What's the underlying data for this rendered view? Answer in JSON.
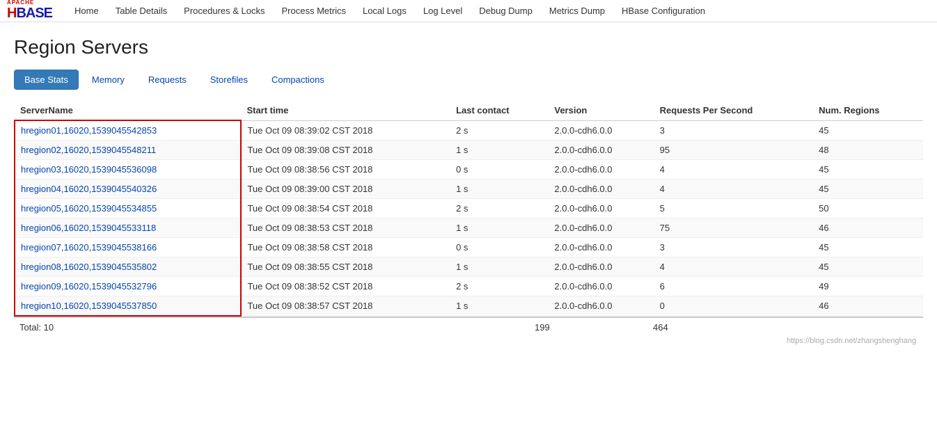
{
  "nav": {
    "links": [
      {
        "label": "Home",
        "name": "home-link"
      },
      {
        "label": "Table Details",
        "name": "table-details-link"
      },
      {
        "label": "Procedures & Locks",
        "name": "procedures-locks-link"
      },
      {
        "label": "Process Metrics",
        "name": "process-metrics-link"
      },
      {
        "label": "Local Logs",
        "name": "local-logs-link"
      },
      {
        "label": "Log Level",
        "name": "log-level-link"
      },
      {
        "label": "Debug Dump",
        "name": "debug-dump-link"
      },
      {
        "label": "Metrics Dump",
        "name": "metrics-dump-link"
      },
      {
        "label": "HBase Configuration",
        "name": "hbase-config-link"
      }
    ]
  },
  "page": {
    "title": "Region Servers"
  },
  "tabs": [
    {
      "label": "Base Stats",
      "active": true,
      "name": "tab-base-stats"
    },
    {
      "label": "Memory",
      "active": false,
      "name": "tab-memory"
    },
    {
      "label": "Requests",
      "active": false,
      "name": "tab-requests"
    },
    {
      "label": "Storefiles",
      "active": false,
      "name": "tab-storefiles"
    },
    {
      "label": "Compactions",
      "active": false,
      "name": "tab-compactions"
    }
  ],
  "table": {
    "columns": [
      {
        "label": "ServerName",
        "name": "col-server-name"
      },
      {
        "label": "Start time",
        "name": "col-start-time"
      },
      {
        "label": "Last contact",
        "name": "col-last-contact"
      },
      {
        "label": "Version",
        "name": "col-version"
      },
      {
        "label": "Requests Per Second",
        "name": "col-rps"
      },
      {
        "label": "Num. Regions",
        "name": "col-num-regions"
      }
    ],
    "rows": [
      {
        "server": "hregion01,16020,1539045542853",
        "start_time": "Tue Oct 09 08:39:02 CST 2018",
        "last_contact": "2 s",
        "version": "2.0.0-cdh6.0.0",
        "rps": "3",
        "regions": "45"
      },
      {
        "server": "hregion02,16020,1539045548211",
        "start_time": "Tue Oct 09 08:39:08 CST 2018",
        "last_contact": "1 s",
        "version": "2.0.0-cdh6.0.0",
        "rps": "95",
        "regions": "48"
      },
      {
        "server": "hregion03,16020,1539045536098",
        "start_time": "Tue Oct 09 08:38:56 CST 2018",
        "last_contact": "0 s",
        "version": "2.0.0-cdh6.0.0",
        "rps": "4",
        "regions": "45"
      },
      {
        "server": "hregion04,16020,1539045540326",
        "start_time": "Tue Oct 09 08:39:00 CST 2018",
        "last_contact": "1 s",
        "version": "2.0.0-cdh6.0.0",
        "rps": "4",
        "regions": "45"
      },
      {
        "server": "hregion05,16020,1539045534855",
        "start_time": "Tue Oct 09 08:38:54 CST 2018",
        "last_contact": "2 s",
        "version": "2.0.0-cdh6.0.0",
        "rps": "5",
        "regions": "50"
      },
      {
        "server": "hregion06,16020,1539045533118",
        "start_time": "Tue Oct 09 08:38:53 CST 2018",
        "last_contact": "1 s",
        "version": "2.0.0-cdh6.0.0",
        "rps": "75",
        "regions": "46"
      },
      {
        "server": "hregion07,16020,1539045538166",
        "start_time": "Tue Oct 09 08:38:58 CST 2018",
        "last_contact": "0 s",
        "version": "2.0.0-cdh6.0.0",
        "rps": "3",
        "regions": "45"
      },
      {
        "server": "hregion08,16020,1539045535802",
        "start_time": "Tue Oct 09 08:38:55 CST 2018",
        "last_contact": "1 s",
        "version": "2.0.0-cdh6.0.0",
        "rps": "4",
        "regions": "45"
      },
      {
        "server": "hregion09,16020,1539045532796",
        "start_time": "Tue Oct 09 08:38:52 CST 2018",
        "last_contact": "2 s",
        "version": "2.0.0-cdh6.0.0",
        "rps": "6",
        "regions": "49"
      },
      {
        "server": "hregion10,16020,1539045537850",
        "start_time": "Tue Oct 09 08:38:57 CST 2018",
        "last_contact": "1 s",
        "version": "2.0.0-cdh6.0.0",
        "rps": "0",
        "regions": "46"
      }
    ],
    "totals": {
      "label": "Total: 10",
      "rps": "199",
      "regions": "464"
    }
  },
  "watermark": "https://blog.csdn.net/zhangshenghang"
}
